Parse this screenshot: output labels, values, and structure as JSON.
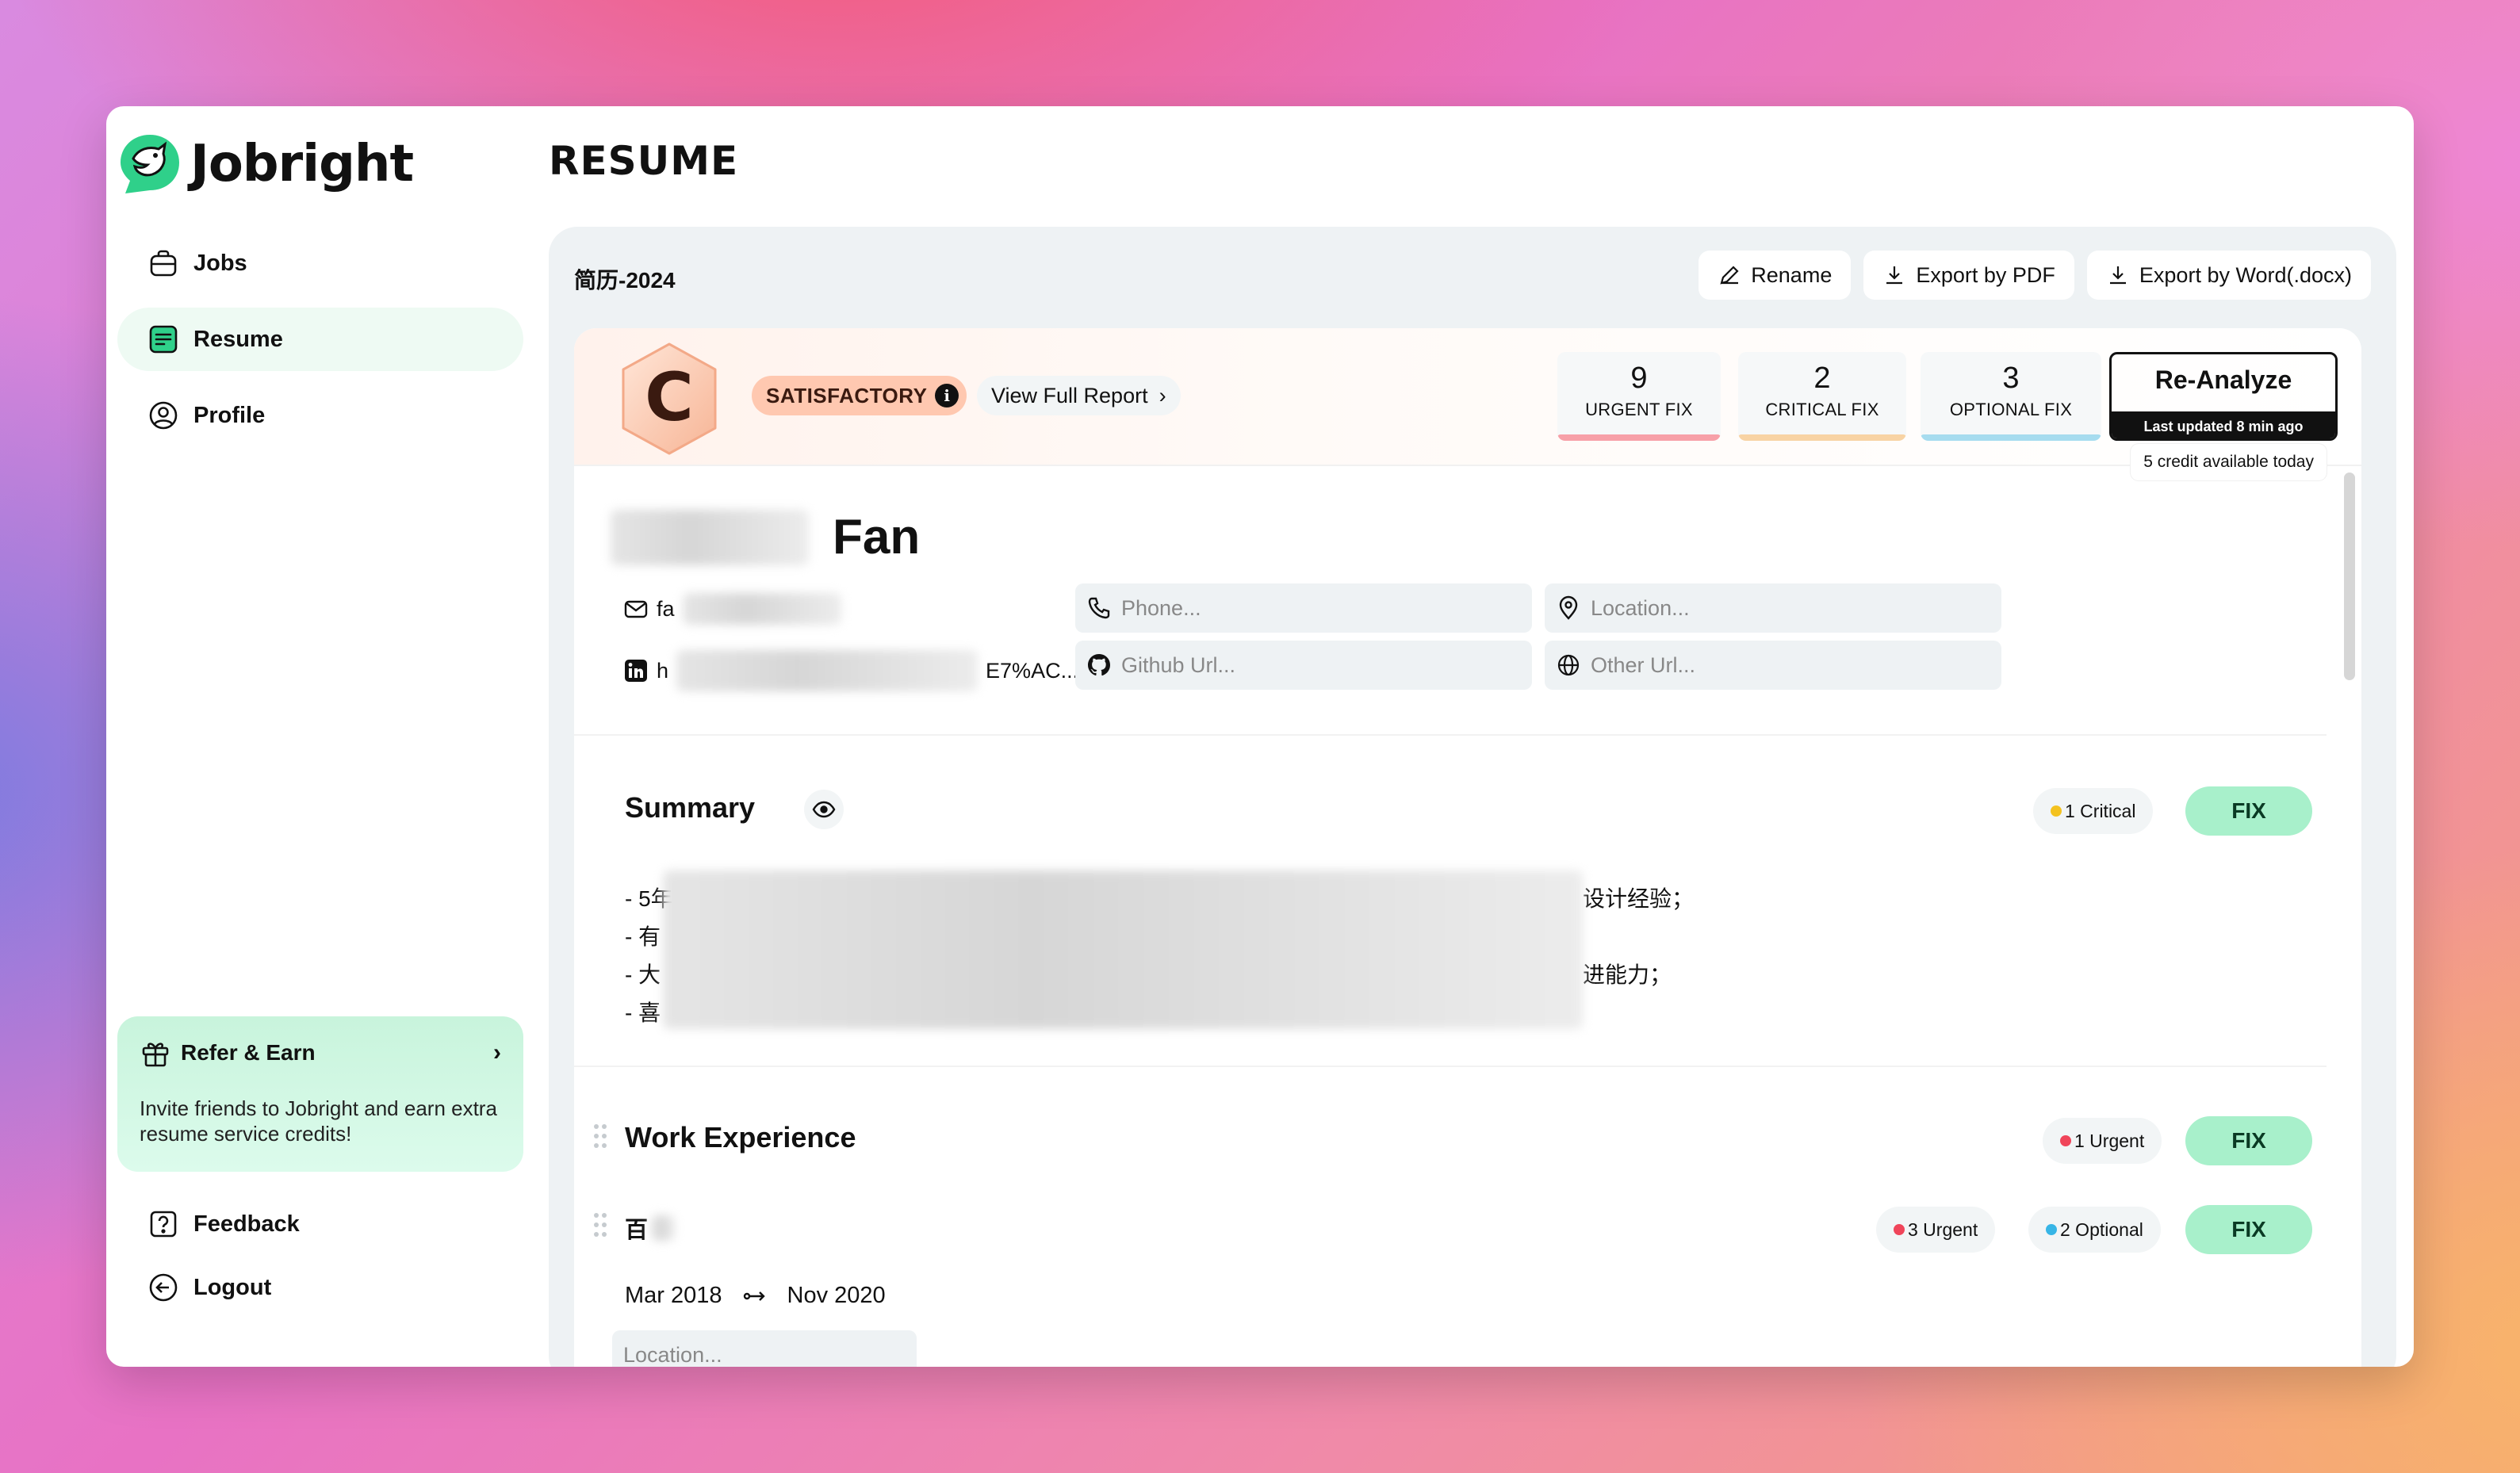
{
  "app": {
    "name": "Jobright",
    "page_title": "RESUME"
  },
  "sidebar": {
    "items": [
      {
        "label": "Jobs",
        "icon": "briefcase-icon"
      },
      {
        "label": "Resume",
        "icon": "resume-icon",
        "active": true
      },
      {
        "label": "Profile",
        "icon": "user-circle-icon"
      }
    ],
    "refer": {
      "title": "Refer & Earn",
      "text": "Invite friends to Jobright and earn extra resume service credits!"
    },
    "bottom": [
      {
        "label": "Feedback",
        "icon": "question-icon"
      },
      {
        "label": "Logout",
        "icon": "logout-icon"
      }
    ]
  },
  "toolbar": {
    "doc_name": "简历-2024",
    "rename": "Rename",
    "export_pdf": "Export by PDF",
    "export_word": "Export by Word(.docx)"
  },
  "score": {
    "grade": "C",
    "status": "SATISFACTORY",
    "view_report": "View Full Report",
    "urgent": {
      "count": "9",
      "label": "URGENT FIX",
      "color": "#f7a0a8"
    },
    "critical": {
      "count": "2",
      "label": "CRITICAL FIX",
      "color": "#f8d3a4"
    },
    "optional": {
      "count": "3",
      "label": "OPTIONAL FIX",
      "color": "#a6dcef"
    },
    "reanalyze": "Re-Analyze",
    "last_updated": "Last updated 8 min ago",
    "credits": "5 credit available today"
  },
  "resume": {
    "last_name": "Fan",
    "email_prefix": "fa",
    "linkedin_prefix": "h",
    "linkedin_suffix": "E7%AC...",
    "phone_placeholder": "Phone...",
    "location_placeholder": "Location...",
    "github_placeholder": "Github Url...",
    "other_placeholder": "Other Url..."
  },
  "summary": {
    "title": "Summary",
    "badge": "1 Critical",
    "fix": "FIX",
    "lines": [
      {
        "start": "- 5年",
        "end": "设计经验；"
      },
      {
        "start": "- 有",
        "end": ""
      },
      {
        "start": "- 大",
        "end": "进能力；"
      },
      {
        "start": "- 喜",
        "end": ""
      }
    ]
  },
  "work": {
    "title": "Work Experience",
    "badge": "1 Urgent",
    "fix": "FIX",
    "entry": {
      "company": "百",
      "urgent": "3 Urgent",
      "optional": "2 Optional",
      "fix": "FIX",
      "start": "Mar 2018",
      "end": "Nov 2020",
      "location_placeholder": "Location..."
    }
  },
  "colors": {
    "brand_green": "#2fd08a",
    "fix_button": "#a8f0cb",
    "urgent_dot": "#f0455a",
    "critical_dot": "#f4c21f",
    "optional_dot": "#37b5e6"
  }
}
